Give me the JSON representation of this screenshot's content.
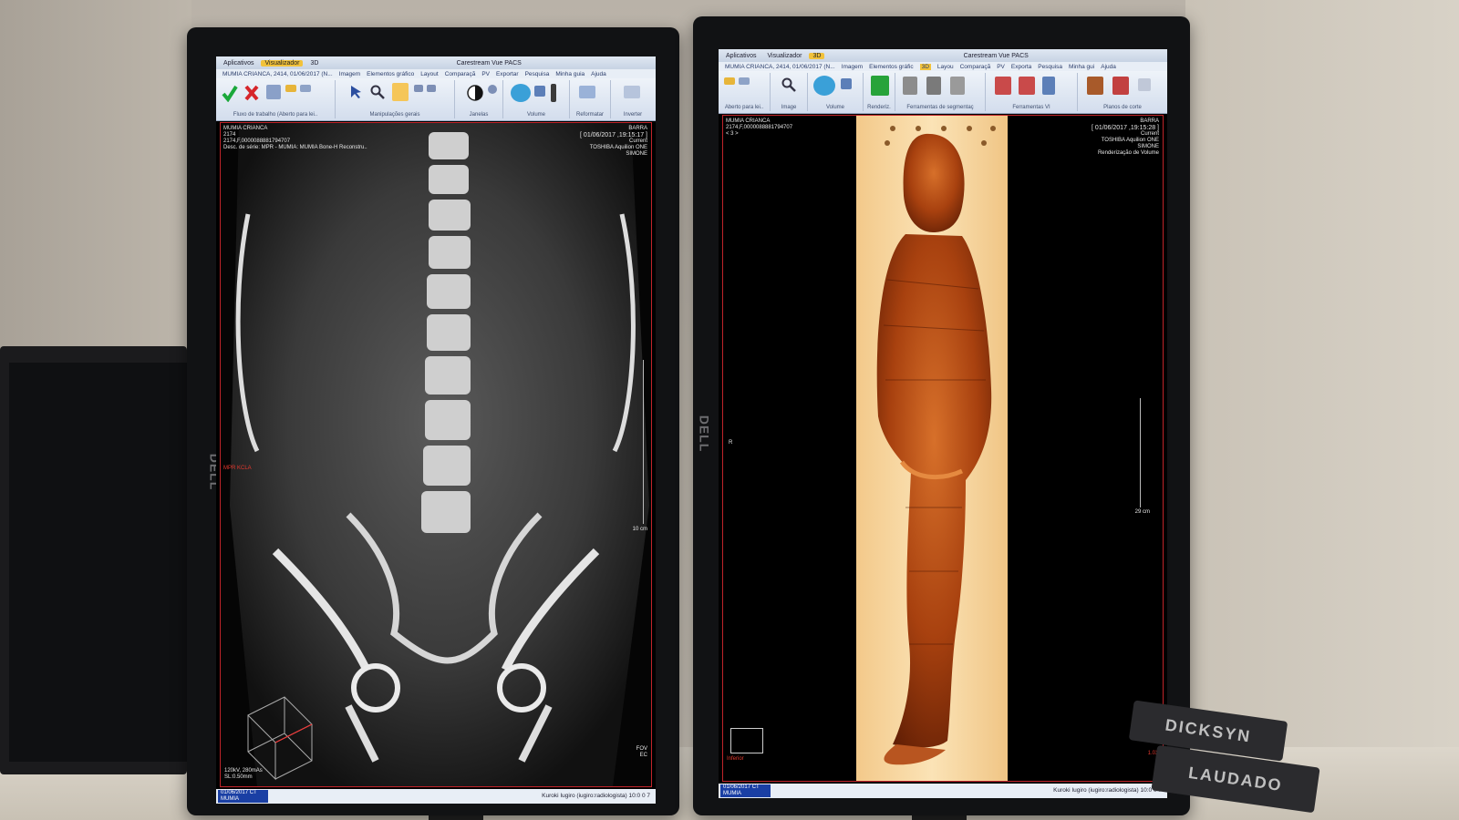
{
  "left": {
    "tabs": [
      "Aplicativos",
      "Visualizador",
      "3D"
    ],
    "app_title": "Carestream Vue PACS",
    "menu": [
      "MUMIA CRIANCA, 2414, 01/06/2017 (N...",
      "Imagem",
      "Elementos gráfico",
      "Layout",
      "Comparaçã",
      "PV",
      "Exportar",
      "Pesquisa",
      "Minha guia",
      "Ajuda"
    ],
    "groups": [
      "Fluxo de trabalho (Aberto para lei..",
      "Manipulações gerais",
      "Janelas",
      "Volume",
      "Reformatar",
      "Inverter"
    ],
    "ov_tl": [
      "MUMIA CRIANCA",
      "2174",
      "2174,F,0000088881794707",
      "Desc. de série: MPR - MUMIA: MUMIA Bone-H Reconstru.."
    ],
    "ov_tr": [
      "BARRA",
      "[ 01/06/2017 ,19:15:17 ]",
      "Current",
      "TOSHIBA Aquilion ONE",
      "SIMONE"
    ],
    "ov_left_red": "MPR KCLA",
    "ov_bl": [
      "120kV, 280mAs",
      "SL:0.50mm"
    ],
    "scale": "10 cm",
    "ov_br": [
      "FOV",
      "EC"
    ],
    "study": "01/06/2017 CT MUMIA",
    "user": "Kuroki Iugiro (iugiro:radiologista)    10:0 0 7"
  },
  "right": {
    "tabs": [
      "Aplicativos",
      "Visualizador",
      "3D"
    ],
    "app_title": "Carestream Vue PACS",
    "menu": [
      "MUMIA CRIANCA, 2414, 01/06/2017 (N...",
      "Imagem",
      "Elementos gráfic",
      "3D",
      "Layou",
      "Comparaçã",
      "PV",
      "Exporta",
      "Pesquisa",
      "Minha gui",
      "Ajuda"
    ],
    "groups": [
      "Aberto para lei..",
      "Image",
      "Volume",
      "Renderiz.",
      "Ferramentas de segmentaç",
      "Ferramentas VI",
      "Planos de corte"
    ],
    "ov_tl": [
      "MUMIA CRIANCA",
      "2174,F,0000088881794707",
      "< 3 >"
    ],
    "ov_tr": [
      "BARRA",
      "[ 01/06/2017 ,19:15:28 ]",
      "Current",
      "TOSHIBA Aquilion ONE",
      "SIMONE",
      "Renderização de Volume"
    ],
    "marker_r": "R",
    "scale": "29 cm",
    "ov_bl_red": "Inferior",
    "ov_br": "1.0X",
    "study": "01/06/2017 CT MUMIA",
    "user": "Kuroki Iugiro (iugiro:radiologista)    10:0 0 7"
  },
  "bezel_logo": "DELL",
  "keyboard_top": "DICKSYN",
  "keyboard_bottom": "LAUDADO"
}
